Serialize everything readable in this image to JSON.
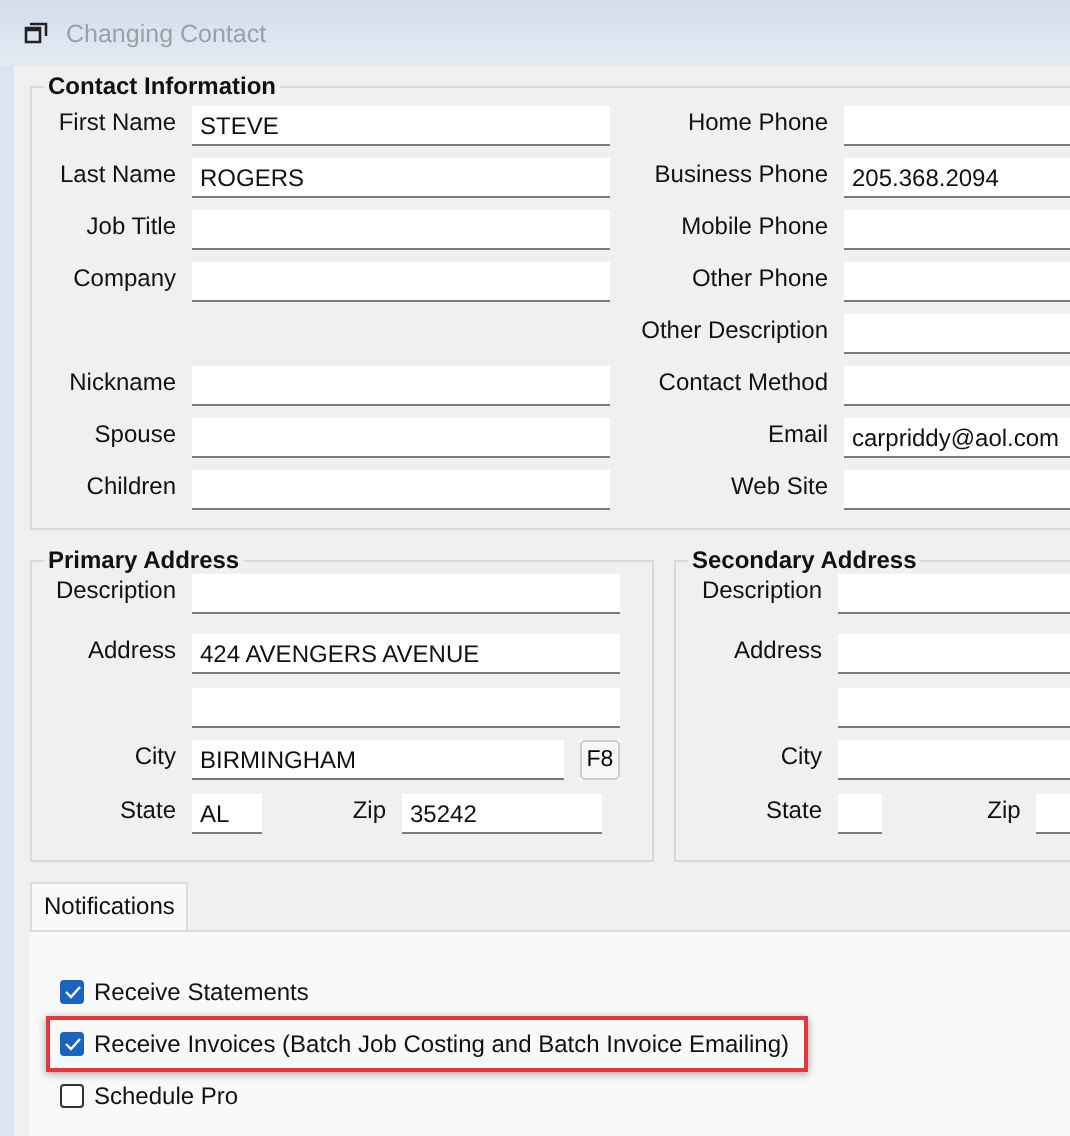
{
  "window": {
    "title": "Changing Contact"
  },
  "contact_information": {
    "title": "Contact Information",
    "rows": [
      {
        "left": {
          "label": "First Name",
          "value": "STEVE"
        },
        "right": {
          "label": "Home Phone"
        }
      },
      {
        "left": {
          "label": "Last Name",
          "value": "ROGERS"
        },
        "right": {
          "label": "Business Phone",
          "value": "205.368.2094"
        }
      },
      {
        "left": {
          "label": "Job Title"
        },
        "right": {
          "label": "Mobile Phone"
        }
      },
      {
        "left": {
          "label": "Company"
        },
        "right": {
          "label": "Other Phone"
        }
      },
      {
        "right": {
          "label": "Other Description"
        }
      },
      {
        "left": {
          "label": "Nickname"
        },
        "right": {
          "label": "Contact Method"
        }
      },
      {
        "left": {
          "label": "Spouse"
        },
        "right": {
          "label": "Email",
          "value": "carpriddy@aol.com"
        }
      },
      {
        "left": {
          "label": "Children"
        },
        "right": {
          "label": "Web Site"
        }
      }
    ]
  },
  "addresses": [
    {
      "title": "Primary Address",
      "description": {
        "label": "Description"
      },
      "address": {
        "label": "Address",
        "value": "424 AVENGERS AVENUE"
      },
      "city": {
        "label": "City",
        "value": "BIRMINGHAM",
        "lookup_button": "F8"
      },
      "state": {
        "label": "State",
        "value": "AL"
      },
      "zip": {
        "label": "Zip",
        "value": "35242"
      }
    },
    {
      "title": "Secondary Address",
      "description": {
        "label": "Description"
      },
      "address": {
        "label": "Address"
      },
      "city": {
        "label": "City"
      },
      "state": {
        "label": "State"
      },
      "zip": {
        "label": "Zip"
      }
    }
  ],
  "tabs": [
    {
      "label": "Notifications",
      "selected": true
    }
  ],
  "notifications": [
    {
      "label": "Receive Statements",
      "checked": true,
      "highlighted": false
    },
    {
      "label": "Receive Invoices (Batch Job Costing and Batch Invoice Emailing)",
      "checked": true,
      "highlighted": true
    },
    {
      "label": "Schedule Pro",
      "checked": false,
      "highlighted": false
    }
  ]
}
